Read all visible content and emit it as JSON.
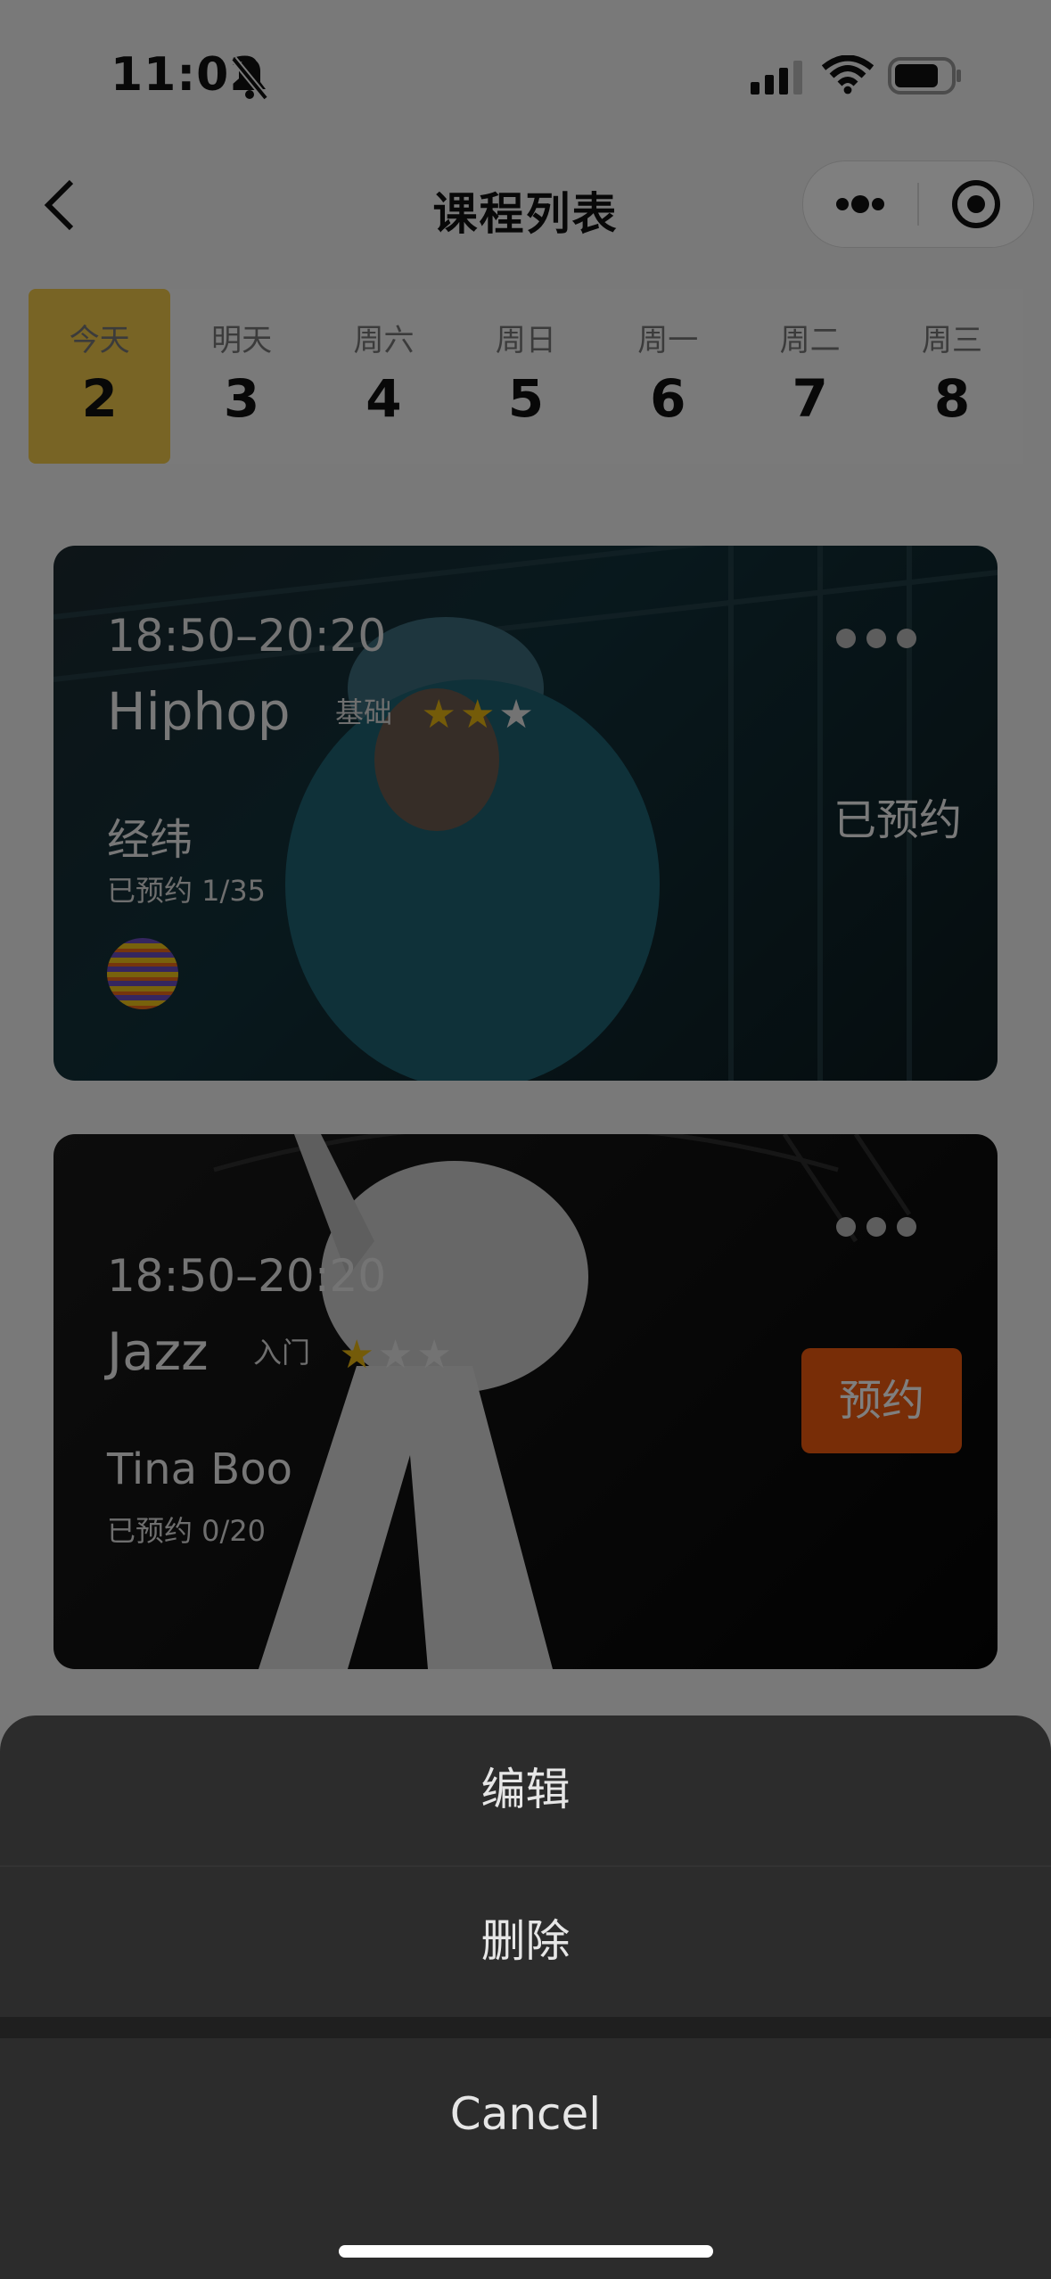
{
  "status_bar": {
    "time": "11:02"
  },
  "nav": {
    "title": "课程列表"
  },
  "dates": [
    {
      "day": "今天",
      "num": "2"
    },
    {
      "day": "明天",
      "num": "3"
    },
    {
      "day": "周六",
      "num": "4"
    },
    {
      "day": "周日",
      "num": "5"
    },
    {
      "day": "周一",
      "num": "6"
    },
    {
      "day": "周二",
      "num": "7"
    },
    {
      "day": "周三",
      "num": "8"
    }
  ],
  "active_date_index": 0,
  "courses": [
    {
      "time": "18:50–20:20",
      "name": "Hiphop",
      "level": "基础",
      "stars_filled": 2,
      "stars_total": 3,
      "teacher": "经纬",
      "booked": "已预约 1/35",
      "status": "已预约"
    },
    {
      "time": "18:50–20:20",
      "name": "Jazz",
      "level": "入门",
      "stars_filled": 1,
      "stars_total": 3,
      "teacher": "Tina Boo",
      "booked": "已预约 0/20",
      "button": "预约"
    }
  ],
  "action_sheet": {
    "items": [
      "编辑",
      "删除"
    ],
    "cancel": "Cancel"
  },
  "colors": {
    "active_date": "#f0c84a",
    "book_button": "#f15a0f",
    "star": "#e9b612",
    "sheet_bg": "#2c2c2c"
  }
}
